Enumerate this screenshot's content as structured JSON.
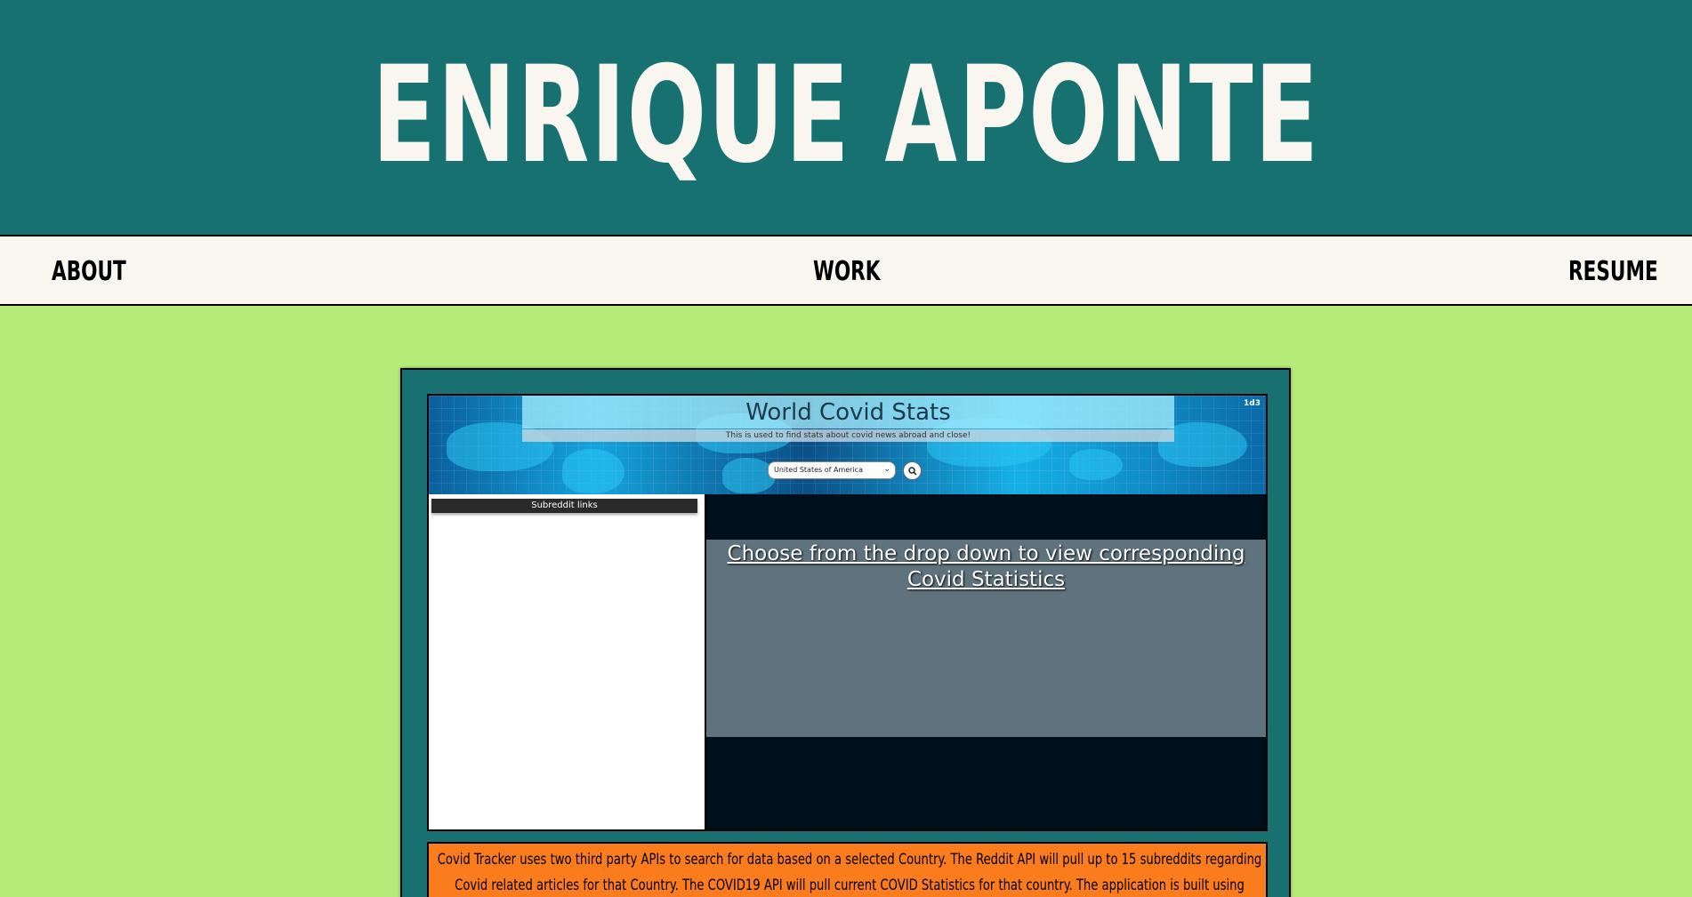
{
  "site": {
    "title": "ENRIQUE APONTE"
  },
  "nav": {
    "about": "ABOUT",
    "work": "WORK",
    "resume": "RESUME"
  },
  "project": {
    "title": "World Covid Stats",
    "subtitle": "This is used to find stats about covid news abroad and close!",
    "corner_tag": "1d3",
    "country_select": {
      "value": "United States of America"
    },
    "reddit_header": "Subreddit links",
    "stats_message": "Choose from the drop down to view corresponding Covid Statistics",
    "description": "Covid Tracker uses two third party APIs to search for data based on a selected Country. The Reddit API will pull up to 15 subreddits regarding Covid related articles for that Country. The COVID19 API will pull current COVID Statistics for that country. The application is built using HTML, CSS, Bootstrap and Javascript."
  },
  "colors": {
    "header_bg": "#177170",
    "body_bg": "#b7eb78",
    "nav_bg": "#f8f6ee",
    "desc_bg": "#fb7c1d"
  },
  "icons": [
    "search-icon",
    "chevron-down-icon"
  ]
}
